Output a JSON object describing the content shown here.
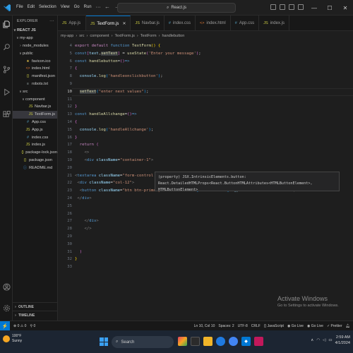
{
  "titlebar": {
    "menu": [
      "File",
      "Edit",
      "Selection",
      "View",
      "Go",
      "Run"
    ],
    "menu_more": "···",
    "search": "React.js"
  },
  "sidebar": {
    "title": "EXPLORER",
    "section": "REACT JS",
    "items": [
      {
        "label": "my-app",
        "indent": 1,
        "chev": "∨",
        "icon": "",
        "color": "#ccc"
      },
      {
        "label": "node_modules",
        "indent": 2,
        "chev": "›",
        "icon": "",
        "color": "#ccc"
      },
      {
        "label": "public",
        "indent": 2,
        "chev": "∨",
        "icon": "",
        "color": "#ccc"
      },
      {
        "label": "favicon.ico",
        "indent": 3,
        "chev": "",
        "icon": "★",
        "iconColor": "#e8c54a",
        "color": "#ccc"
      },
      {
        "label": "index.html",
        "indent": 3,
        "chev": "",
        "icon": "<>",
        "iconColor": "#e37933",
        "color": "#ccc"
      },
      {
        "label": "manifest.json",
        "indent": 3,
        "chev": "",
        "icon": "{}",
        "iconColor": "#cbcb41",
        "color": "#ccc"
      },
      {
        "label": "robots.txt",
        "indent": 3,
        "chev": "",
        "icon": "≡",
        "iconColor": "#9aa",
        "color": "#ccc"
      },
      {
        "label": "src",
        "indent": 2,
        "chev": "∨",
        "icon": "",
        "color": "#ccc"
      },
      {
        "label": "component",
        "indent": 3,
        "chev": "∨",
        "icon": "",
        "color": "#ccc"
      },
      {
        "label": "Navbar.js",
        "indent": 4,
        "chev": "",
        "icon": "JS",
        "iconColor": "#cbcb41",
        "color": "#ccc"
      },
      {
        "label": "TextForm.js",
        "indent": 4,
        "chev": "",
        "icon": "JS",
        "iconColor": "#cbcb41",
        "color": "#ccc",
        "selected": true
      },
      {
        "label": "App.css",
        "indent": 3,
        "chev": "",
        "icon": "#",
        "iconColor": "#519aba",
        "color": "#ccc"
      },
      {
        "label": "App.js",
        "indent": 3,
        "chev": "",
        "icon": "JS",
        "iconColor": "#cbcb41",
        "color": "#ccc"
      },
      {
        "label": "index.css",
        "indent": 3,
        "chev": "",
        "icon": "#",
        "iconColor": "#519aba",
        "color": "#ccc"
      },
      {
        "label": "index.js",
        "indent": 3,
        "chev": "",
        "icon": "JS",
        "iconColor": "#cbcb41",
        "color": "#ccc"
      },
      {
        "label": "package-lock.json",
        "indent": 2,
        "chev": "",
        "icon": "{}",
        "iconColor": "#cbcb41",
        "color": "#ccc"
      },
      {
        "label": "package.json",
        "indent": 2,
        "chev": "",
        "icon": "{}",
        "iconColor": "#cbcb41",
        "color": "#ccc"
      },
      {
        "label": "README.md",
        "indent": 2,
        "chev": "",
        "icon": "ⓘ",
        "iconColor": "#42a5f5",
        "color": "#ccc"
      }
    ],
    "outline": "OUTLINE",
    "timeline": "TIMELINE"
  },
  "tabs": [
    {
      "label": "App.js",
      "icon": "JS",
      "active": false
    },
    {
      "label": "TextForm.js",
      "icon": "JS",
      "active": true
    },
    {
      "label": "Navbar.js",
      "icon": "JS",
      "active": false
    },
    {
      "label": "index.css",
      "icon": "#",
      "active": false
    },
    {
      "label": "index.html",
      "icon": "<>",
      "active": false
    },
    {
      "label": "App.css",
      "icon": "#",
      "active": false
    },
    {
      "label": "index.js",
      "icon": "JS",
      "active": false
    }
  ],
  "breadcrumb": [
    "my-app",
    "src",
    "component",
    "TextForm.js",
    "TextForm",
    "handlebutton"
  ],
  "editor": {
    "current_line": 10,
    "line_count": 33
  },
  "hover": {
    "line1": "(property) JSX.IntrinsicElements.button:",
    "line2": "React.DetailedHTMLProps<React.ButtonHTMLAttributes<HTMLButtonElement>, HTMLButtonElement>"
  },
  "activate": {
    "title": "Activate Windows",
    "subtitle": "Go to Settings to activate Windows."
  },
  "statusbar": {
    "errors": "0",
    "warnings": "0",
    "ports": "0",
    "position": "Ln 10, Col 10",
    "spaces": "Spaces: 2",
    "encoding": "UTF-8",
    "eol": "CRLF",
    "lang": "{} JavaScript",
    "golive1": "Go Live",
    "golive2": "Go Live",
    "prettier": "✓ Prettier"
  },
  "taskbar": {
    "temp": "100°F",
    "weather": "Sunny",
    "search": "Search",
    "time": "2:59 AM",
    "date": "4/1/2024"
  },
  "colors": {
    "accent": "#0078d4",
    "editor_bg": "#1e1e1e",
    "sidebar_bg": "#181818"
  }
}
